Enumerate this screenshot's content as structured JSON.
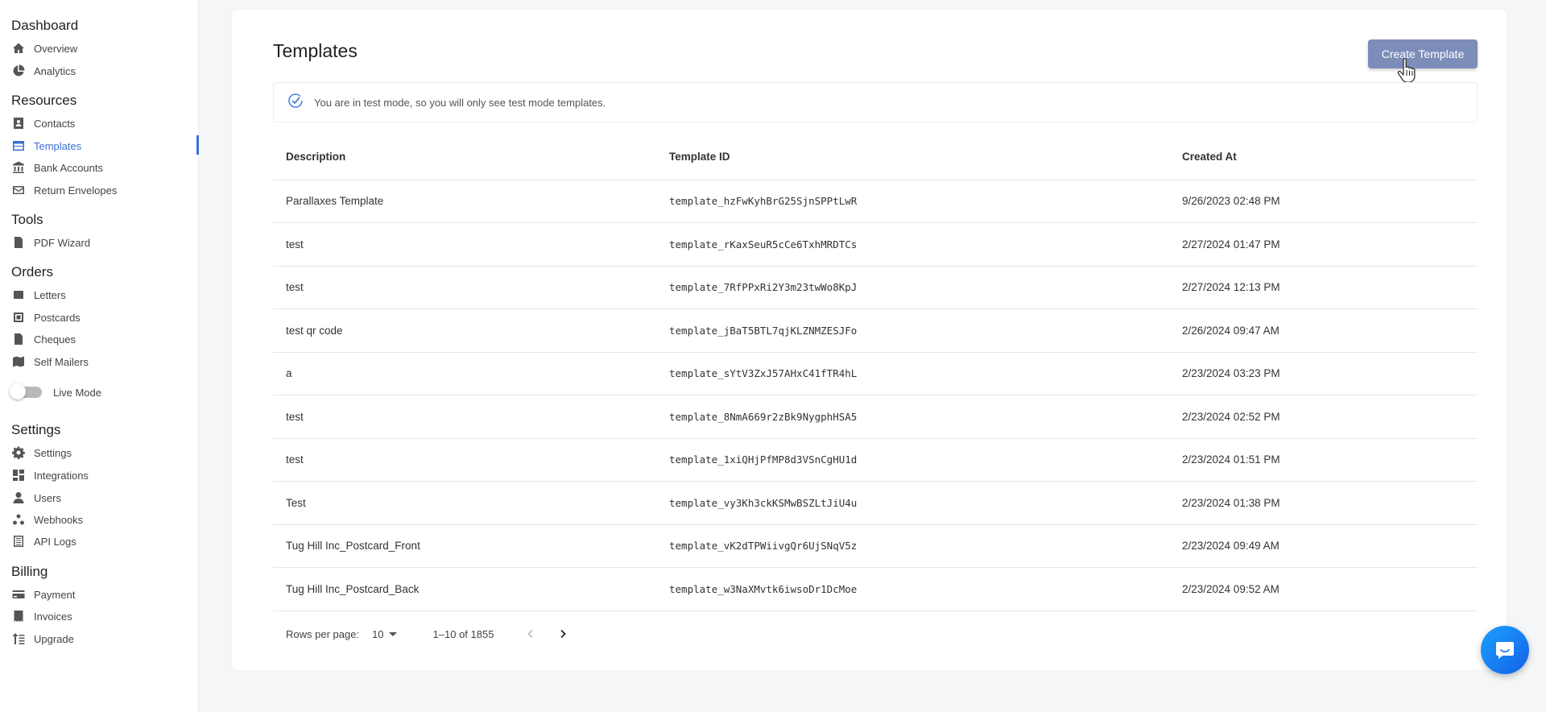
{
  "sidebar": {
    "sections": [
      {
        "title": "Dashboard",
        "items": [
          {
            "label": "Overview",
            "icon": "home-icon"
          },
          {
            "label": "Analytics",
            "icon": "pie-chart-icon"
          }
        ]
      },
      {
        "title": "Resources",
        "items": [
          {
            "label": "Contacts",
            "icon": "contact-book-icon"
          },
          {
            "label": "Templates",
            "icon": "template-icon"
          },
          {
            "label": "Bank Accounts",
            "icon": "bank-icon"
          },
          {
            "label": "Return Envelopes",
            "icon": "envelope-icon"
          }
        ]
      },
      {
        "title": "Tools",
        "items": [
          {
            "label": "PDF Wizard",
            "icon": "pdf-wizard-icon"
          }
        ]
      },
      {
        "title": "Orders",
        "items": [
          {
            "label": "Letters",
            "icon": "letters-icon"
          },
          {
            "label": "Postcards",
            "icon": "postcard-icon"
          },
          {
            "label": "Cheques",
            "icon": "cheque-icon"
          },
          {
            "label": "Self Mailers",
            "icon": "map-icon"
          }
        ]
      },
      {
        "title": "Settings",
        "items": [
          {
            "label": "Settings",
            "icon": "gear-icon"
          },
          {
            "label": "Integrations",
            "icon": "integrations-icon"
          },
          {
            "label": "Users",
            "icon": "user-icon"
          },
          {
            "label": "Webhooks",
            "icon": "webhook-icon"
          },
          {
            "label": "API Logs",
            "icon": "list-icon"
          }
        ]
      },
      {
        "title": "Billing",
        "items": [
          {
            "label": "Payment",
            "icon": "payment-icon"
          },
          {
            "label": "Invoices",
            "icon": "invoice-icon"
          },
          {
            "label": "Upgrade",
            "icon": "upgrade-icon"
          }
        ]
      }
    ],
    "live_mode_label": "Live Mode",
    "live_mode_on": false,
    "active_item": "Templates"
  },
  "header": {
    "title": "Templates",
    "create_button": "Create Template"
  },
  "notice": {
    "text": "You are in test mode, so you will only see test mode templates."
  },
  "table": {
    "columns": [
      "Description",
      "Template ID",
      "Created At"
    ],
    "rows": [
      {
        "description": "Parallaxes Template",
        "id": "template_hzFwKyhBrG25SjnSPPtLwR",
        "created": "9/26/2023 02:48 PM"
      },
      {
        "description": "test",
        "id": "template_rKaxSeuR5cCe6TxhMRDTCs",
        "created": "2/27/2024 01:47 PM"
      },
      {
        "description": "test",
        "id": "template_7RfPPxRi2Y3m23twWo8KpJ",
        "created": "2/27/2024 12:13 PM"
      },
      {
        "description": "test qr code",
        "id": "template_jBaT5BTL7qjKLZNMZESJFo",
        "created": "2/26/2024 09:47 AM"
      },
      {
        "description": "a",
        "id": "template_sYtV3ZxJ57AHxC41fTR4hL",
        "created": "2/23/2024 03:23 PM"
      },
      {
        "description": "test",
        "id": "template_8NmA669r2zBk9NygphHSA5",
        "created": "2/23/2024 02:52 PM"
      },
      {
        "description": "test",
        "id": "template_1xiQHjPfMP8d3VSnCgHU1d",
        "created": "2/23/2024 01:51 PM"
      },
      {
        "description": "Test",
        "id": "template_vy3Kh3ckKSMwBSZLtJiU4u",
        "created": "2/23/2024 01:38 PM"
      },
      {
        "description": "Tug Hill Inc_Postcard_Front",
        "id": "template_vK2dTPWiivgQr6UjSNqV5z",
        "created": "2/23/2024 09:49 AM"
      },
      {
        "description": "Tug Hill Inc_Postcard_Back",
        "id": "template_w3NaXMvtk6iwsoDr1DcMoe",
        "created": "2/23/2024 09:52 AM"
      }
    ]
  },
  "pagination": {
    "rows_per_page_label": "Rows per page:",
    "rows_per_page": "10",
    "range": "1–10 of 1855"
  },
  "colors": {
    "accent": "#3b6fd6",
    "create_button": "#7d8db9",
    "chat_fab": "#1a7cf5"
  }
}
